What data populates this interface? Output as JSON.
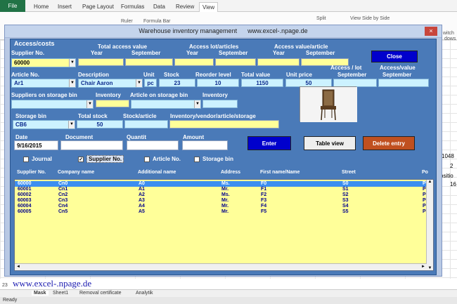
{
  "excel": {
    "tabs": [
      "File",
      "Home",
      "Insert",
      "Page Layout",
      "Formulas",
      "Data",
      "Review",
      "View"
    ],
    "ribbon": {
      "ruler": "Ruler",
      "formula_bar": "Formula Bar",
      "split": "Split",
      "view_side": "View Side by Side",
      "switch": "witch",
      "windows": "dows"
    },
    "right_cells": [
      "1048",
      "2",
      "ositio",
      "16"
    ],
    "row_23": "23",
    "watermark": "www.excel-.npage.de",
    "sheet_tabs": [
      "Mask",
      "Sheet1",
      "Removal certificate",
      "Analytik"
    ],
    "status": "Ready"
  },
  "dialog": {
    "title": "Warehouse inventory management",
    "url": "www.excel-.npage.de",
    "close": "×",
    "frame_label": "Access/costs",
    "supplier_no_label": "Supplier No.",
    "supplier_no": "60000",
    "total_access_value": "Total access value",
    "access_lot_articles": "Access lot/articles",
    "access_value_article": "Access value/article",
    "year": "Year",
    "september": "September",
    "close_button": "Close",
    "article_no_label": "Article No.",
    "article_no": "Ar1",
    "description_label": "Description",
    "description": "Chair Aaron",
    "unit_label": "Unit",
    "unit": "pc",
    "stock_label": "Stock",
    "stock": "23",
    "reorder_label": "Reorder level",
    "reorder": "10",
    "total_value_label": "Total value",
    "total_value": "1150",
    "unit_price_label": "Unit price",
    "unit_price": "50",
    "access_lot_label": "Access / lot",
    "access_value_label": "Access/value",
    "suppliers_on_bin_label": "Suppliers on storage bin",
    "inventory_label": "Inventory",
    "article_on_bin_label": "Article on storage bin",
    "inventory_label2": "Inventory",
    "storage_bin_label": "Storage bin",
    "storage_bin": "CB6",
    "total_stock_label": "Total stock",
    "total_stock": "50",
    "stock_article_label": "Stock/article",
    "inv_vendor_label": "Inventory/vendor/article/storage",
    "date_label": "Date",
    "date": "9/16/2015",
    "document_label": "Document",
    "quantity_label": "Quantit",
    "amount_label": "Amount",
    "enter_button": "Enter",
    "table_view_button": "Table view",
    "delete_button": "Delete entry",
    "checks": {
      "journal": "Journal",
      "supplier": "Supplier No.",
      "article": "Article No.",
      "bin": "Storage bin"
    },
    "list_headers": [
      "Supplier No.",
      "Company name",
      "Additional name",
      "Address",
      "First name/Name",
      "Street",
      "Po"
    ],
    "list_rows": [
      [
        "60000",
        "Cn0",
        "A0",
        "Ms.",
        "F0",
        "S0",
        "Pc"
      ],
      [
        "60001",
        "Cn1",
        "A1",
        "Mr.",
        "F1",
        "S1",
        "Pc1"
      ],
      [
        "60002",
        "Cn2",
        "A2",
        "Ms.",
        "F2",
        "S2",
        "Pc2"
      ],
      [
        "60003",
        "Cn3",
        "A3",
        "Mr.",
        "F3",
        "S3",
        "Pc3"
      ],
      [
        "60004",
        "Cn4",
        "A4",
        "Mr.",
        "F4",
        "S4",
        "Pc4"
      ],
      [
        "60005",
        "Cn5",
        "A5",
        "Mr.",
        "F5",
        "S5",
        "Pc5"
      ]
    ],
    "colors": {
      "panel": "#4a7ab8",
      "yellow": "#ffff99",
      "cyan": "#ccf2ff",
      "enter": "#0000cc",
      "delete": "#c0501f",
      "selected": "#3c8ef0"
    }
  }
}
